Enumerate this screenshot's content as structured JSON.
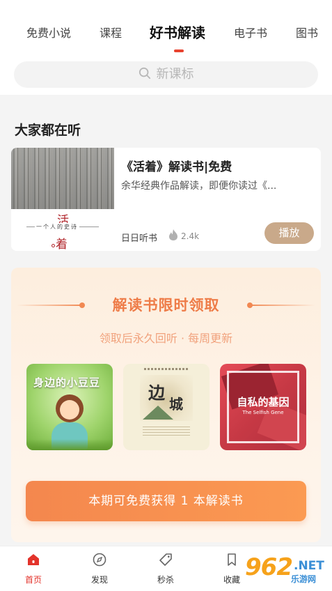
{
  "tabs": [
    "免费小说",
    "课程",
    "好书解读",
    "电子书",
    "图书"
  ],
  "active_tab": "好书解读",
  "search": {
    "placeholder": "新课标"
  },
  "section": {
    "title": "大家都在听"
  },
  "card": {
    "title": "《活着》解读书|免费",
    "desc": "余华经典作品解读，即便你读过《...",
    "author": "日日听书",
    "count": "2.4k",
    "play_label": "播放",
    "cover": {
      "title_top": "活",
      "subtitle": "一个人的史诗",
      "title_bottom": "着"
    }
  },
  "promo": {
    "title": "解读书限时领取",
    "subtitle": "领取后永久回听 · 每周更新",
    "books": [
      {
        "title": "身边的小豆豆",
        "icon": "book-cover-girl"
      },
      {
        "title_a": "边",
        "title_b": "城",
        "icon": "book-cover-landscape"
      },
      {
        "title": "自私的基因",
        "subtitle": "The Selfish Gene",
        "icon": "book-cover-abstract"
      }
    ],
    "claim_label": "本期可免费获得 1 本解读书"
  },
  "nav": [
    {
      "label": "首页",
      "icon": "home-icon",
      "active": true
    },
    {
      "label": "发现",
      "icon": "compass-icon",
      "active": false
    },
    {
      "label": "秒杀",
      "icon": "tag-icon",
      "active": false
    },
    {
      "label": "收藏",
      "icon": "bookmark-icon",
      "active": false
    }
  ],
  "watermark": {
    "number": "962",
    "domain": ".NET",
    "name": "乐游网"
  },
  "colors": {
    "accent": "#e8432f",
    "promo_orange": "#f4874e",
    "play_button": "#c9a98a"
  }
}
